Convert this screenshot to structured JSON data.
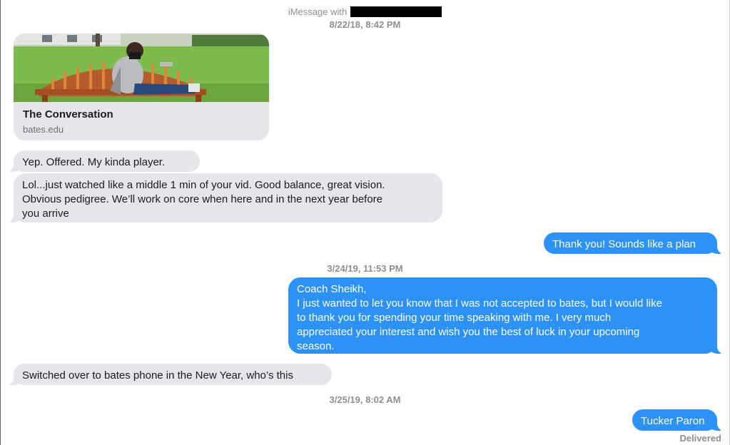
{
  "header": {
    "prefix": "iMessage with"
  },
  "messages": {
    "ts1": "8/22/18, 8:42 PM",
    "link_title": "The Conversation",
    "link_domain": "bates.edu",
    "m1": "Yep.  Offered.  My kinda player.",
    "m2": "Lol...just watched like a middle 1 min of your vid.  Good balance, great vision.\n Obvious pedigree.  We’ll work on core when here and in the next year before\nyou arrive",
    "m3": "Thank you! Sounds like a plan",
    "ts2": "3/24/19, 11:53 PM",
    "m4": "Coach Sheikh,\nI just wanted to let you know that I was not accepted to bates, but I would like\nto thank you for spending your time speaking with me. I very much\nappreciated your interest and wish you the best of luck in your upcoming\nseason.",
    "m5": "Switched over to bates phone in the New Year, who’s this",
    "ts3": "3/25/19, 8:02 AM",
    "m6": "Tucker Paron",
    "status": "Delivered"
  },
  "colors": {
    "incoming_bubble": "#e5e5ea",
    "outgoing_bubble": "#2c92f5",
    "meta_text": "#8e8e93"
  }
}
